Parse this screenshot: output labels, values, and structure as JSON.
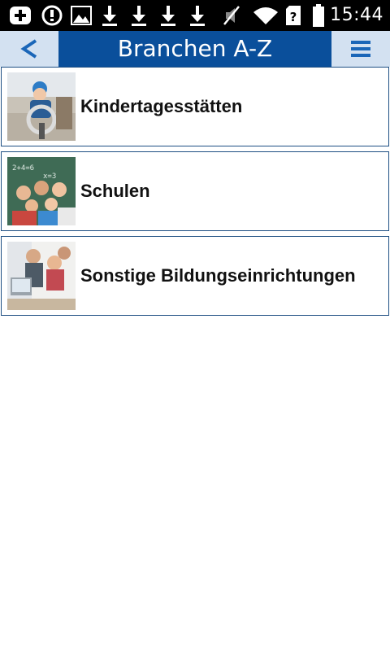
{
  "statusbar": {
    "time": "15:44",
    "icons": [
      "add-icon",
      "info-icon",
      "image-icon",
      "download-icon",
      "download-icon",
      "download-icon",
      "download-icon",
      "mute-icon",
      "wifi-icon",
      "unknown-sim-icon",
      "battery-icon"
    ]
  },
  "header": {
    "title": "Branchen A-Z",
    "back_label": "<",
    "menu_icon": "hamburger-icon",
    "colors": {
      "bar": "#0a4f9b",
      "buttons": "#d3e1f1",
      "accent": "#1a66b8"
    }
  },
  "list": {
    "items": [
      {
        "label": "Kindertagesstätten",
        "image": "child-on-playground-image"
      },
      {
        "label": "Schulen",
        "image": "schoolchildren-at-chalkboard-image"
      },
      {
        "label": "Sonstige Bildungseinrichtungen",
        "image": "adults-learning-at-computer-image"
      }
    ]
  }
}
